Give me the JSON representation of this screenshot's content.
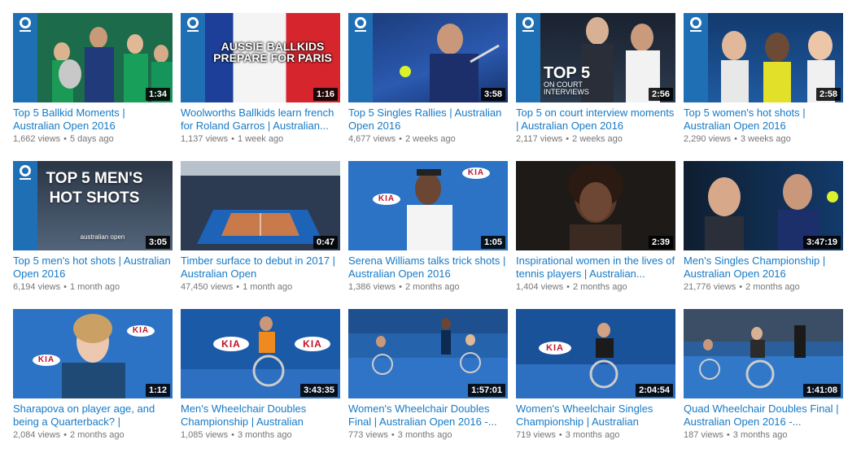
{
  "rows": [
    [
      {
        "title": "Top 5 Ballkid Moments | Australian Open 2016",
        "views": "1,662 views",
        "age": "5 days ago",
        "duration": "1:34",
        "overlay": ""
      },
      {
        "title": "Woolworths Ballkids learn french for Roland Garros | Australian...",
        "views": "1,137 views",
        "age": "1 week ago",
        "duration": "1:16",
        "overlay": "AUSSIE BALLKIDS PREPARE FOR PARIS"
      },
      {
        "title": "Top 5 Singles Rallies | Australian Open 2016",
        "views": "4,677 views",
        "age": "2 weeks ago",
        "duration": "3:58",
        "overlay": ""
      },
      {
        "title": "Top 5 on court interview moments | Australian Open 2016",
        "views": "2,117 views",
        "age": "2 weeks ago",
        "duration": "2:56",
        "overlay": "TOP 5",
        "overlay_sub": "ON COURT INTERVIEWS"
      },
      {
        "title": "Top 5 women's hot shots | Australian Open 2016",
        "views": "2,290 views",
        "age": "3 weeks ago",
        "duration": "2:58",
        "overlay": ""
      }
    ],
    [
      {
        "title": "Top 5 men's hot shots | Australian Open 2016",
        "views": "6,194 views",
        "age": "1 month ago",
        "duration": "3:05",
        "overlay": "TOP 5 MEN'S HOT SHOTS",
        "overlay_sub": "australian open"
      },
      {
        "title": "Timber surface to debut in 2017 | Australian Open",
        "views": "47,450 views",
        "age": "1 month ago",
        "duration": "0:47",
        "overlay": ""
      },
      {
        "title": "Serena Williams talks trick shots | Australian Open 2016",
        "views": "1,386 views",
        "age": "2 months ago",
        "duration": "1:05",
        "overlay": ""
      },
      {
        "title": "Inspirational women in the lives of tennis players | Australian...",
        "views": "1,404 views",
        "age": "2 months ago",
        "duration": "2:39",
        "overlay": ""
      },
      {
        "title": "Men's Singles Championship | Australian Open 2016",
        "views": "21,776 views",
        "age": "2 months ago",
        "duration": "3:47:19",
        "overlay": ""
      }
    ],
    [
      {
        "title": "Sharapova on player age, and being a Quarterback? | Australia...",
        "views": "2,084 views",
        "age": "2 months ago",
        "duration": "1:12",
        "overlay": ""
      },
      {
        "title": "Men's Wheelchair Doubles Championship | Australian Open...",
        "views": "1,085 views",
        "age": "3 months ago",
        "duration": "3:43:35",
        "overlay": ""
      },
      {
        "title": "Women's Wheelchair Doubles Final | Australian Open 2016 -...",
        "views": "773 views",
        "age": "3 months ago",
        "duration": "1:57:01",
        "overlay": ""
      },
      {
        "title": "Women's Wheelchair Singles Championship | Australian Open...",
        "views": "719 views",
        "age": "3 months ago",
        "duration": "2:04:54",
        "overlay": ""
      },
      {
        "title": "Quad Wheelchair Doubles Final | Australian Open 2016 -...",
        "views": "187 views",
        "age": "3 months ago",
        "duration": "1:41:08",
        "overlay": ""
      }
    ]
  ],
  "logo_text": "australian open",
  "sponsor": "KIA",
  "colors": {
    "link": "#167ac6",
    "meta": "#767676",
    "ao_blue": "#1f6fb5",
    "kia_red": "#c0142a"
  }
}
